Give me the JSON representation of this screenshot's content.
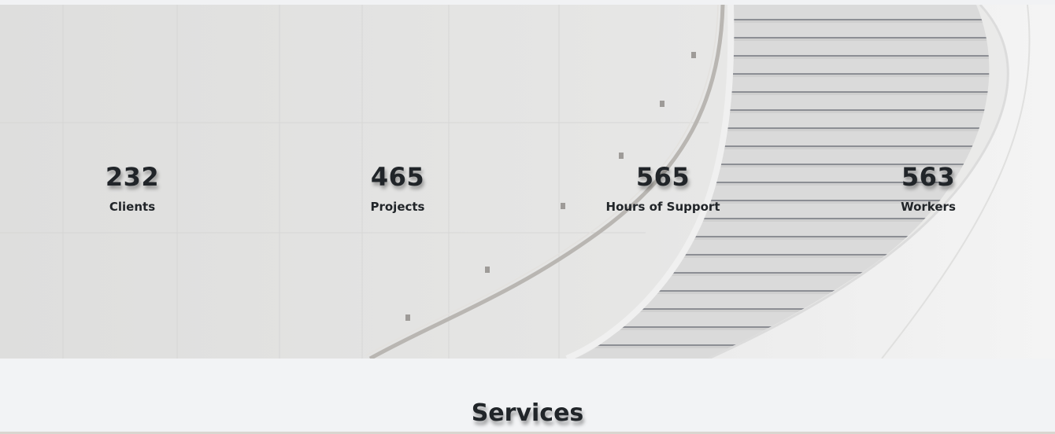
{
  "stats": [
    {
      "value": "232",
      "label": "Clients"
    },
    {
      "value": "465",
      "label": "Projects"
    },
    {
      "value": "565",
      "label": "Hours of Support"
    },
    {
      "value": "563",
      "label": "Workers"
    }
  ],
  "services": {
    "heading": "Services"
  },
  "colors": {
    "page_background": "#f2f3f5",
    "text": "#212529",
    "hero_wall": "#e4e4e3",
    "stair_tread": "#d6d6d6"
  }
}
